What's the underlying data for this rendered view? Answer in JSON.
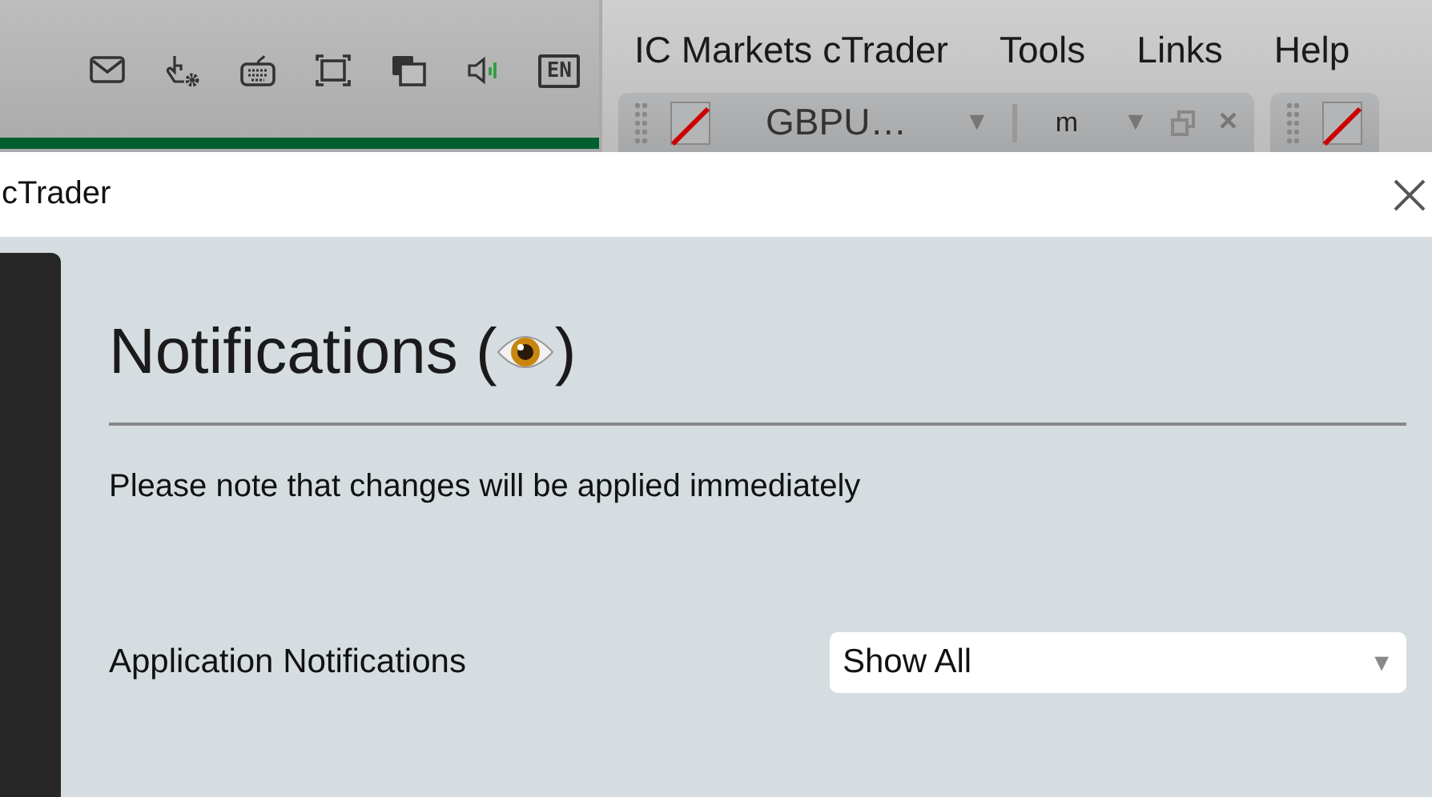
{
  "taskbar": {
    "language": "EN"
  },
  "menu": [
    "IC Markets cTrader",
    "Tools",
    "Links",
    "Help"
  ],
  "chart_tabs": [
    {
      "kind": "full",
      "symbol": "GBPU…",
      "timeframe": "m",
      "caret": "▼",
      "close": "×"
    },
    {
      "kind": "collapsed"
    }
  ],
  "dialog": {
    "title": "cTrader",
    "heading_prefix": "Notifications (",
    "heading_suffix": ")",
    "note": "Please note that changes will be applied immediately",
    "settings": [
      {
        "label": "Application Notifications",
        "value": "Show All",
        "caret": "▼"
      }
    ]
  }
}
